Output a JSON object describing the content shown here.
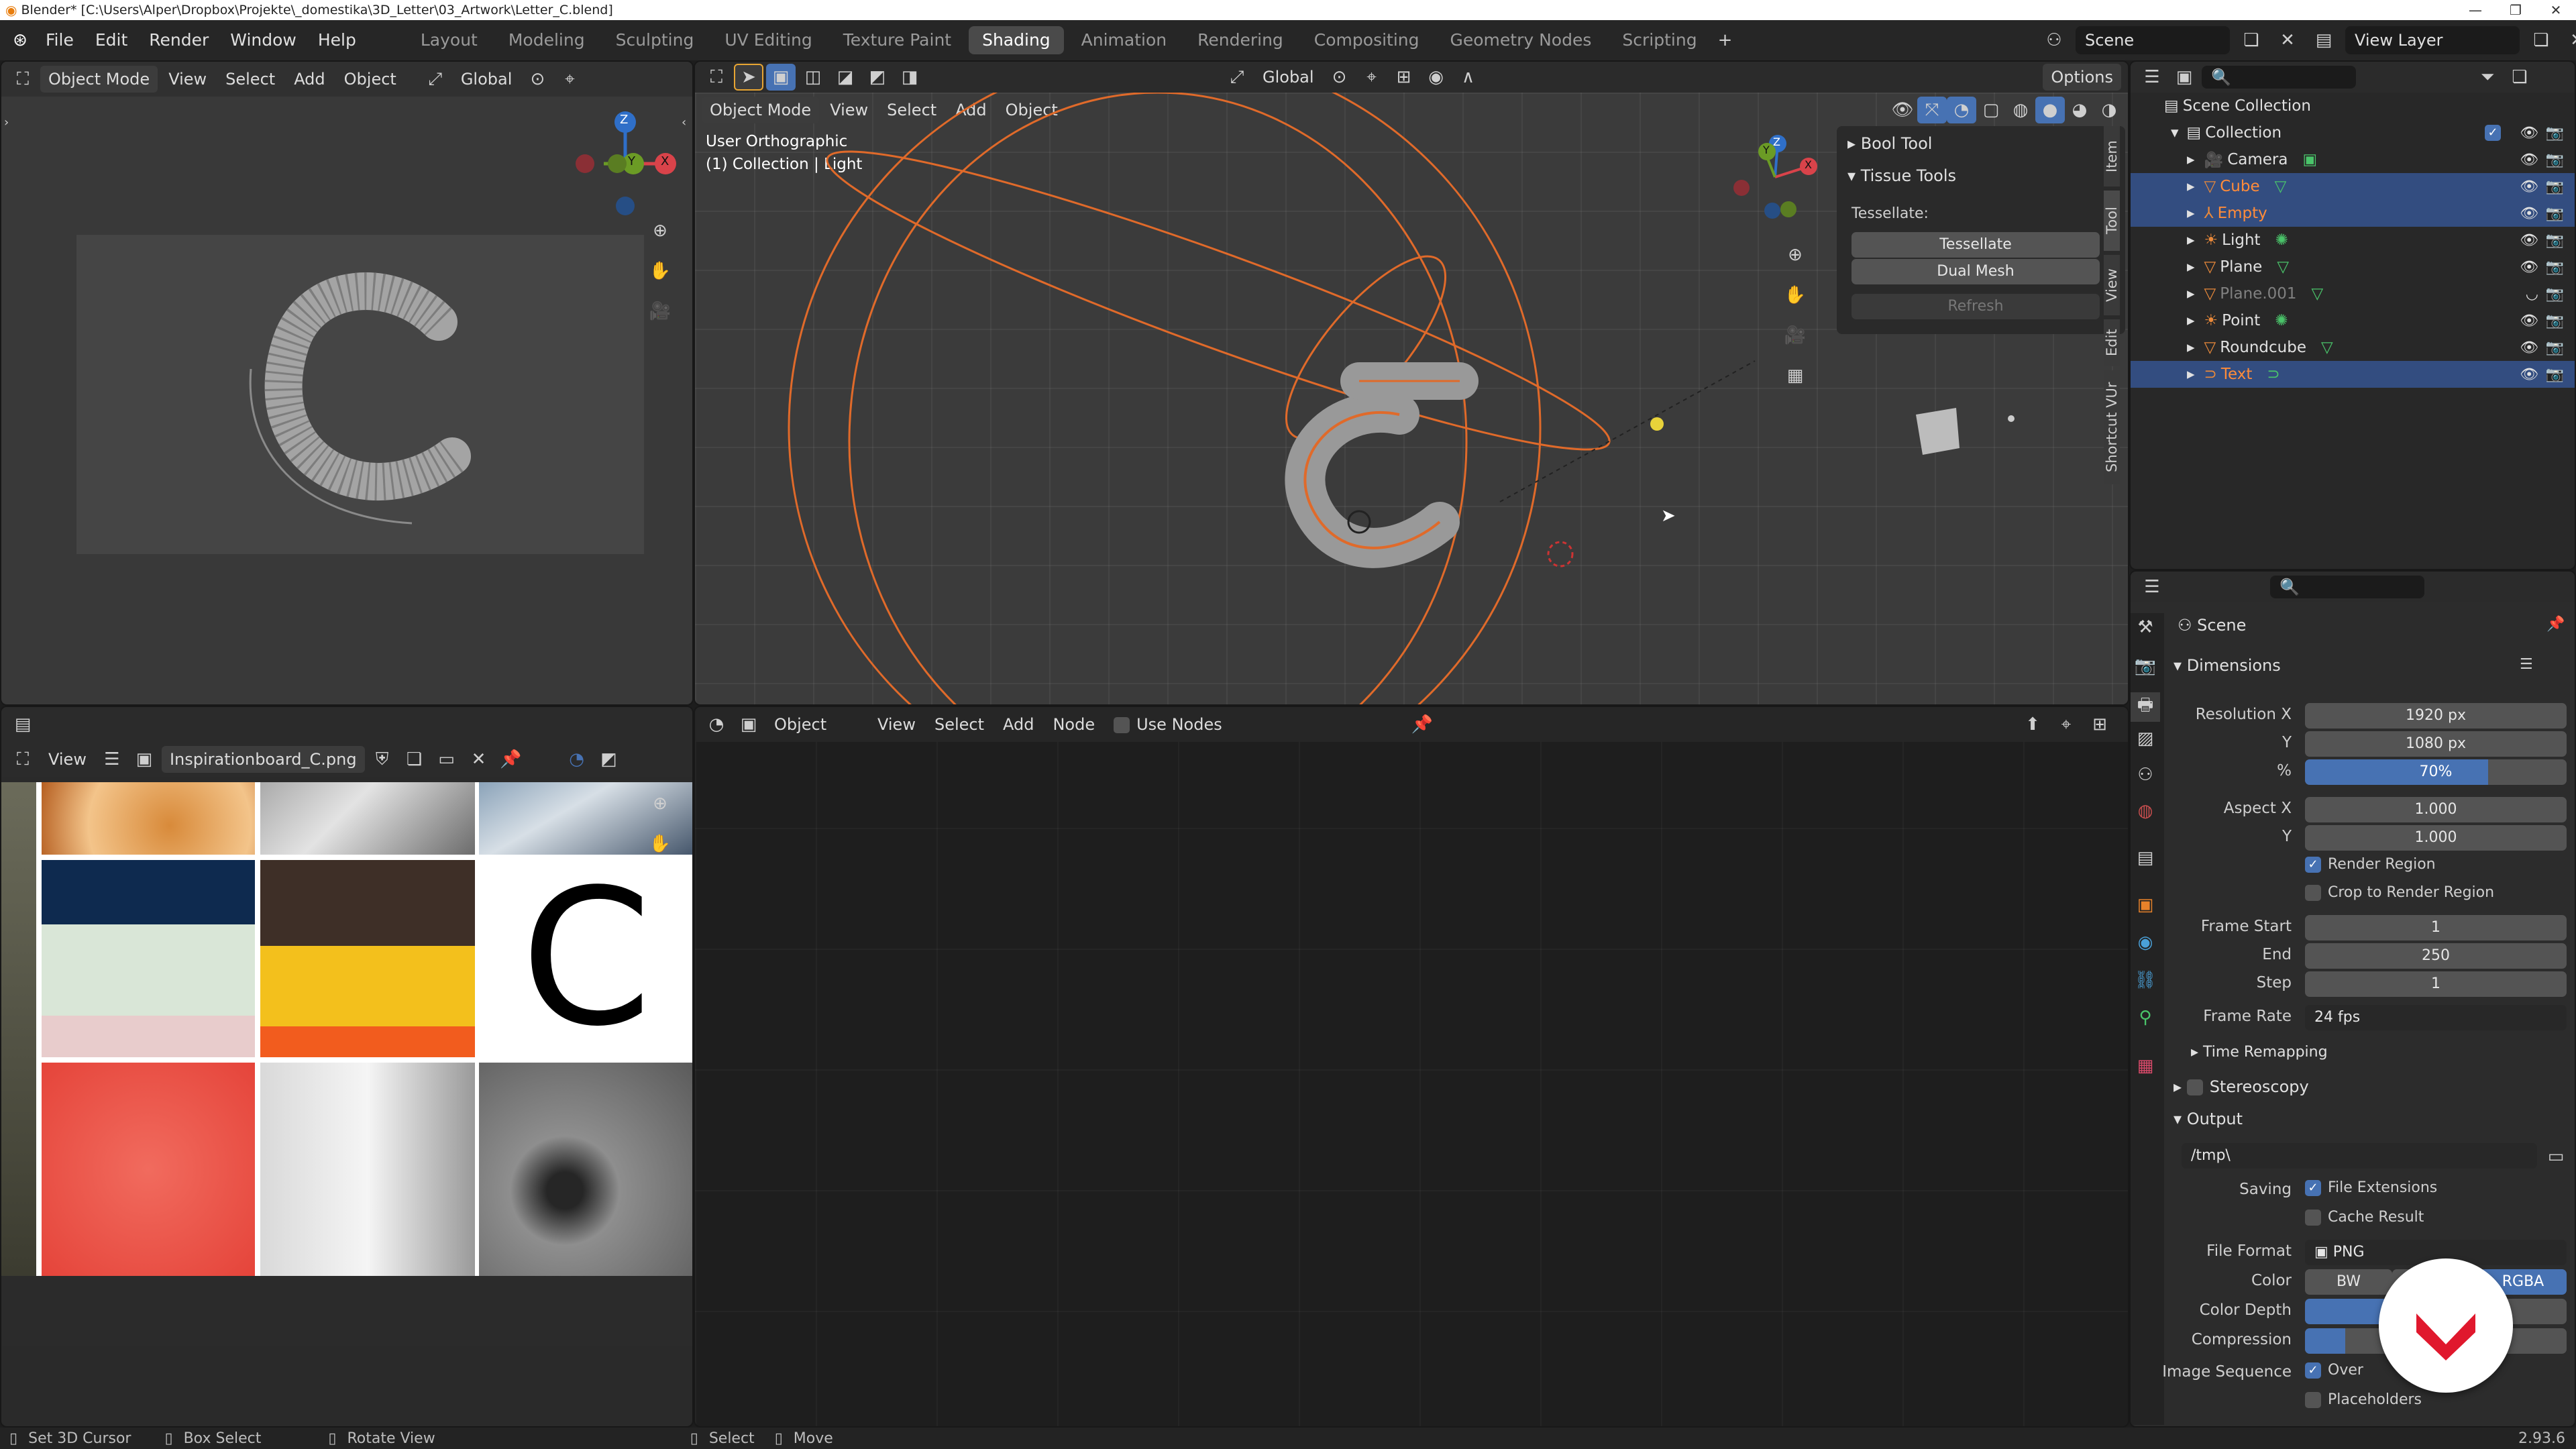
{
  "window": {
    "title": "Blender* [C:\\Users\\Alper\\Dropbox\\Projekte\\_domestika\\3D_Letter\\03_Artwork\\Letter_C.blend]"
  },
  "menus": [
    "File",
    "Edit",
    "Render",
    "Window",
    "Help"
  ],
  "workspaces": [
    {
      "label": "Layout",
      "active": false
    },
    {
      "label": "Modeling",
      "active": false
    },
    {
      "label": "Sculpting",
      "active": false
    },
    {
      "label": "UV Editing",
      "active": false
    },
    {
      "label": "Texture Paint",
      "active": false
    },
    {
      "label": "Shading",
      "active": true
    },
    {
      "label": "Animation",
      "active": false
    },
    {
      "label": "Rendering",
      "active": false
    },
    {
      "label": "Compositing",
      "active": false
    },
    {
      "label": "Geometry Nodes",
      "active": false
    },
    {
      "label": "Scripting",
      "active": false
    }
  ],
  "topright": {
    "scene": "Scene",
    "view_layer": "View Layer"
  },
  "left_viewport": {
    "mode": "Object Mode",
    "menus": [
      "View",
      "Select",
      "Add",
      "Object"
    ],
    "orientation": "Global",
    "gizmo_axes": [
      "Z",
      "Y",
      "X"
    ]
  },
  "main_viewport": {
    "mode": "Object Mode",
    "menus": [
      "View",
      "Select",
      "Add",
      "Object"
    ],
    "orientation": "Global",
    "options": "Options",
    "view_name": "User Orthographic",
    "view_context": "(1) Collection | Light",
    "gizmo_axes": [
      "Z",
      "Y",
      "X"
    ],
    "side_tabs": [
      "Item",
      "Tool",
      "View",
      "Edit",
      "Shortcut VUr"
    ],
    "npanel": {
      "bool_tool": "Bool Tool",
      "tissue_tools": "Tissue Tools",
      "tessellate_label": "Tessellate:",
      "buttons": [
        "Tessellate",
        "Dual Mesh",
        "Refresh"
      ]
    }
  },
  "image_editor": {
    "view": "View",
    "image_name": "Inspirationboard_C.png",
    "letter": "C",
    "swatches": [
      "#0e2a4f",
      "#d9e6d7",
      "#e8cccc",
      "#3e2f27",
      "#f3c01c",
      "#f25c1e"
    ]
  },
  "node_editor": {
    "object": "Object",
    "menus": [
      "View",
      "Select",
      "Add",
      "Node"
    ],
    "use_nodes": "Use Nodes"
  },
  "outliner": {
    "root": "Scene Collection",
    "collection": "Collection",
    "items": [
      {
        "name": "Camera",
        "type": "camera",
        "selected": false,
        "style": "normal"
      },
      {
        "name": "Cube",
        "type": "mesh",
        "selected": true,
        "style": "orange"
      },
      {
        "name": "Empty",
        "type": "empty",
        "selected": true,
        "style": "orange"
      },
      {
        "name": "Light",
        "type": "light",
        "selected": false,
        "style": "normal"
      },
      {
        "name": "Plane",
        "type": "mesh",
        "selected": false,
        "style": "normal"
      },
      {
        "name": "Plane.001",
        "type": "mesh",
        "selected": false,
        "style": "dim"
      },
      {
        "name": "Point",
        "type": "light",
        "selected": false,
        "style": "normal"
      },
      {
        "name": "Roundcube",
        "type": "mesh",
        "selected": false,
        "style": "normal"
      },
      {
        "name": "Text",
        "type": "curve",
        "selected": true,
        "style": "orange"
      }
    ]
  },
  "properties": {
    "context": "Scene",
    "dimensions": {
      "title": "Dimensions",
      "res_x_label": "Resolution X",
      "res_x": "1920 px",
      "y_label": "Y",
      "res_y": "1080 px",
      "pct_label": "%",
      "pct": "70%",
      "pct_fill": 0.7,
      "aspect_x_label": "Aspect X",
      "aspect_x": "1.000",
      "aspect_y_label": "Y",
      "aspect_y": "1.000",
      "render_region": "Render Region",
      "crop": "Crop to Render Region",
      "frame_start_label": "Frame Start",
      "frame_start": "1",
      "end_label": "End",
      "frame_end": "250",
      "step_label": "Step",
      "frame_step": "1",
      "frame_rate_label": "Frame Rate",
      "frame_rate": "24 fps"
    },
    "time_remapping": "Time Remapping",
    "stereoscopy": "Stereoscopy",
    "output": {
      "title": "Output",
      "path": "/tmp\\",
      "saving_label": "Saving",
      "file_ext": "File Extensions",
      "cache": "Cache Result",
      "format_label": "File Format",
      "format": "PNG",
      "color_label": "Color",
      "color_bw": "BW",
      "color_rgba": "RGBA",
      "depth_label": "Color Depth",
      "compression_label": "Compression",
      "img_seq_label": "Image Sequence",
      "overwrite": "Over",
      "placeholders": "Placeholders"
    }
  },
  "status": {
    "items": [
      "Set 3D Cursor",
      "Box Select",
      "Rotate View",
      "Select",
      "Move"
    ],
    "version": "2.93.6"
  }
}
